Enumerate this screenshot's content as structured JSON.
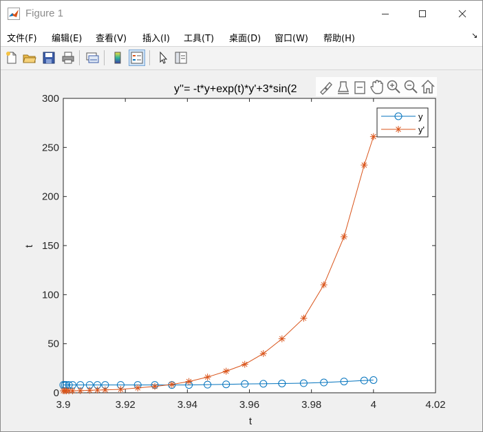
{
  "window": {
    "title": "Figure 1",
    "minimize_glyph": "—",
    "maximize_glyph": "☐",
    "close_glyph": "✕"
  },
  "menu": {
    "items": [
      "文件(F)",
      "编辑(E)",
      "查看(V)",
      "插入(I)",
      "工具(T)",
      "桌面(D)",
      "窗口(W)",
      "帮助(H)"
    ],
    "overflow_glyph": "↘"
  },
  "toolbar": {
    "buttons": [
      {
        "icon": "new-figure-icon"
      },
      {
        "icon": "open-file-icon"
      },
      {
        "icon": "save-icon"
      },
      {
        "icon": "print-icon"
      },
      {
        "icon": "link-plot-icon"
      },
      {
        "icon": "colorbar-icon"
      },
      {
        "icon": "legend-icon",
        "active": true
      },
      {
        "icon": "pointer-icon"
      },
      {
        "icon": "plot-tools-icon"
      }
    ]
  },
  "axes_toolbar": {
    "buttons": [
      "brush-icon",
      "data-tips-icon",
      "zoom-region-icon",
      "pan-icon",
      "zoom-in-icon",
      "zoom-out-icon",
      "home-icon"
    ]
  },
  "colors": {
    "series_y": "#0072bd",
    "series_dy": "#d95319",
    "axes_bg": "#ffffff",
    "figure_bg": "#f0f0f0"
  },
  "chart_data": {
    "type": "line",
    "title": "y''= -t*y+exp(t)*y'+3*sin(2",
    "xlabel": "t",
    "ylabel": "t",
    "xlim": [
      3.9,
      4.02
    ],
    "ylim": [
      0,
      300
    ],
    "xticks": [
      "3.9",
      "3.92",
      "3.94",
      "3.96",
      "3.98",
      "4",
      "4.02"
    ],
    "xtick_values": [
      3.9,
      3.92,
      3.94,
      3.96,
      3.98,
      4.0,
      4.02
    ],
    "yticks": [
      "0",
      "50",
      "100",
      "150",
      "200",
      "250",
      "300"
    ],
    "ytick_values": [
      0,
      50,
      100,
      150,
      200,
      250,
      300
    ],
    "grid": false,
    "legend_position": "top-right",
    "series": [
      {
        "name": "y",
        "marker": "circle",
        "x": [
          3.9,
          3.9005,
          3.901,
          3.9018,
          3.903,
          3.9055,
          3.9085,
          3.911,
          3.9135,
          3.9185,
          3.924,
          3.9295,
          3.935,
          3.9405,
          3.9465,
          3.9525,
          3.9585,
          3.9645,
          3.9705,
          3.9775,
          3.984,
          3.9905,
          3.997,
          4.0
        ],
        "y": [
          8,
          8,
          8,
          8,
          8,
          8,
          8,
          8,
          8,
          8,
          8,
          8,
          8,
          8,
          8.3,
          8.6,
          9,
          9.2,
          9.5,
          9.8,
          10.5,
          11.5,
          12.5,
          13
        ]
      },
      {
        "name": "y'",
        "marker": "star",
        "x": [
          3.9,
          3.9005,
          3.901,
          3.9018,
          3.903,
          3.9055,
          3.9085,
          3.911,
          3.9135,
          3.9185,
          3.924,
          3.9295,
          3.935,
          3.9405,
          3.9465,
          3.9525,
          3.9585,
          3.9645,
          3.9705,
          3.9775,
          3.984,
          3.9905,
          3.997,
          4.0
        ],
        "y": [
          2,
          2,
          2,
          2,
          2,
          2.2,
          2.5,
          2.8,
          3,
          3.5,
          5,
          6.5,
          8.5,
          11.5,
          16,
          22,
          29,
          40,
          55,
          76,
          110,
          159,
          232,
          261
        ]
      }
    ]
  }
}
